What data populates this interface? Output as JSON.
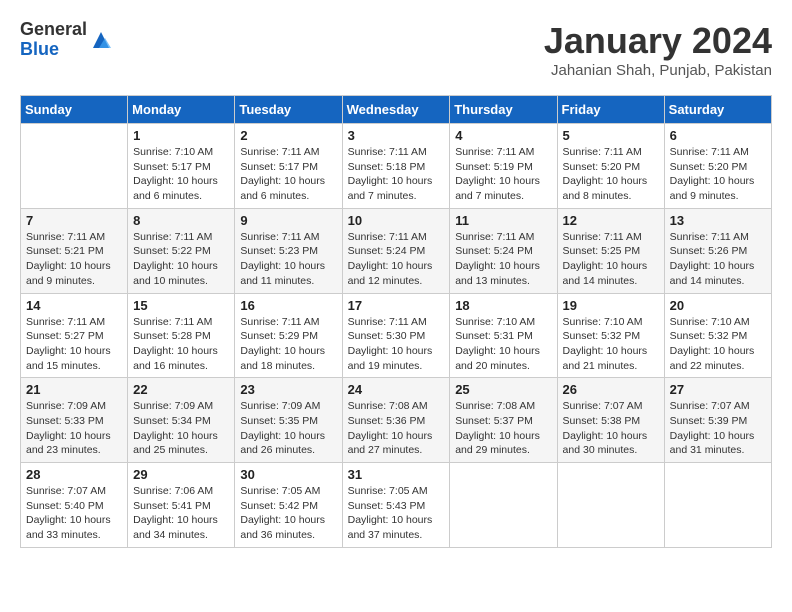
{
  "header": {
    "logo_general": "General",
    "logo_blue": "Blue",
    "month_title": "January 2024",
    "location": "Jahanian Shah, Punjab, Pakistan"
  },
  "calendar": {
    "days_of_week": [
      "Sunday",
      "Monday",
      "Tuesday",
      "Wednesday",
      "Thursday",
      "Friday",
      "Saturday"
    ],
    "weeks": [
      [
        {
          "day": "",
          "info": ""
        },
        {
          "day": "1",
          "info": "Sunrise: 7:10 AM\nSunset: 5:17 PM\nDaylight: 10 hours\nand 6 minutes."
        },
        {
          "day": "2",
          "info": "Sunrise: 7:11 AM\nSunset: 5:17 PM\nDaylight: 10 hours\nand 6 minutes."
        },
        {
          "day": "3",
          "info": "Sunrise: 7:11 AM\nSunset: 5:18 PM\nDaylight: 10 hours\nand 7 minutes."
        },
        {
          "day": "4",
          "info": "Sunrise: 7:11 AM\nSunset: 5:19 PM\nDaylight: 10 hours\nand 7 minutes."
        },
        {
          "day": "5",
          "info": "Sunrise: 7:11 AM\nSunset: 5:20 PM\nDaylight: 10 hours\nand 8 minutes."
        },
        {
          "day": "6",
          "info": "Sunrise: 7:11 AM\nSunset: 5:20 PM\nDaylight: 10 hours\nand 9 minutes."
        }
      ],
      [
        {
          "day": "7",
          "info": "Sunrise: 7:11 AM\nSunset: 5:21 PM\nDaylight: 10 hours\nand 9 minutes."
        },
        {
          "day": "8",
          "info": "Sunrise: 7:11 AM\nSunset: 5:22 PM\nDaylight: 10 hours\nand 10 minutes."
        },
        {
          "day": "9",
          "info": "Sunrise: 7:11 AM\nSunset: 5:23 PM\nDaylight: 10 hours\nand 11 minutes."
        },
        {
          "day": "10",
          "info": "Sunrise: 7:11 AM\nSunset: 5:24 PM\nDaylight: 10 hours\nand 12 minutes."
        },
        {
          "day": "11",
          "info": "Sunrise: 7:11 AM\nSunset: 5:24 PM\nDaylight: 10 hours\nand 13 minutes."
        },
        {
          "day": "12",
          "info": "Sunrise: 7:11 AM\nSunset: 5:25 PM\nDaylight: 10 hours\nand 14 minutes."
        },
        {
          "day": "13",
          "info": "Sunrise: 7:11 AM\nSunset: 5:26 PM\nDaylight: 10 hours\nand 14 minutes."
        }
      ],
      [
        {
          "day": "14",
          "info": "Sunrise: 7:11 AM\nSunset: 5:27 PM\nDaylight: 10 hours\nand 15 minutes."
        },
        {
          "day": "15",
          "info": "Sunrise: 7:11 AM\nSunset: 5:28 PM\nDaylight: 10 hours\nand 16 minutes."
        },
        {
          "day": "16",
          "info": "Sunrise: 7:11 AM\nSunset: 5:29 PM\nDaylight: 10 hours\nand 18 minutes."
        },
        {
          "day": "17",
          "info": "Sunrise: 7:11 AM\nSunset: 5:30 PM\nDaylight: 10 hours\nand 19 minutes."
        },
        {
          "day": "18",
          "info": "Sunrise: 7:10 AM\nSunset: 5:31 PM\nDaylight: 10 hours\nand 20 minutes."
        },
        {
          "day": "19",
          "info": "Sunrise: 7:10 AM\nSunset: 5:32 PM\nDaylight: 10 hours\nand 21 minutes."
        },
        {
          "day": "20",
          "info": "Sunrise: 7:10 AM\nSunset: 5:32 PM\nDaylight: 10 hours\nand 22 minutes."
        }
      ],
      [
        {
          "day": "21",
          "info": "Sunrise: 7:09 AM\nSunset: 5:33 PM\nDaylight: 10 hours\nand 23 minutes."
        },
        {
          "day": "22",
          "info": "Sunrise: 7:09 AM\nSunset: 5:34 PM\nDaylight: 10 hours\nand 25 minutes."
        },
        {
          "day": "23",
          "info": "Sunrise: 7:09 AM\nSunset: 5:35 PM\nDaylight: 10 hours\nand 26 minutes."
        },
        {
          "day": "24",
          "info": "Sunrise: 7:08 AM\nSunset: 5:36 PM\nDaylight: 10 hours\nand 27 minutes."
        },
        {
          "day": "25",
          "info": "Sunrise: 7:08 AM\nSunset: 5:37 PM\nDaylight: 10 hours\nand 29 minutes."
        },
        {
          "day": "26",
          "info": "Sunrise: 7:07 AM\nSunset: 5:38 PM\nDaylight: 10 hours\nand 30 minutes."
        },
        {
          "day": "27",
          "info": "Sunrise: 7:07 AM\nSunset: 5:39 PM\nDaylight: 10 hours\nand 31 minutes."
        }
      ],
      [
        {
          "day": "28",
          "info": "Sunrise: 7:07 AM\nSunset: 5:40 PM\nDaylight: 10 hours\nand 33 minutes."
        },
        {
          "day": "29",
          "info": "Sunrise: 7:06 AM\nSunset: 5:41 PM\nDaylight: 10 hours\nand 34 minutes."
        },
        {
          "day": "30",
          "info": "Sunrise: 7:05 AM\nSunset: 5:42 PM\nDaylight: 10 hours\nand 36 minutes."
        },
        {
          "day": "31",
          "info": "Sunrise: 7:05 AM\nSunset: 5:43 PM\nDaylight: 10 hours\nand 37 minutes."
        },
        {
          "day": "",
          "info": ""
        },
        {
          "day": "",
          "info": ""
        },
        {
          "day": "",
          "info": ""
        }
      ]
    ]
  }
}
